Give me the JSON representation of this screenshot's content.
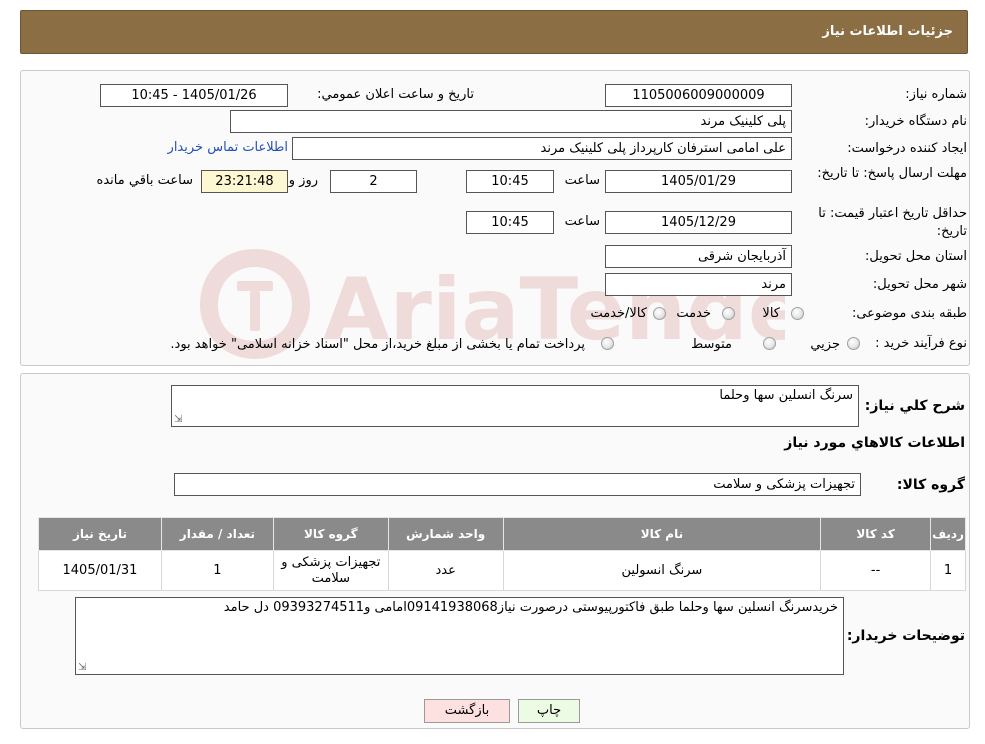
{
  "header": {
    "title": "جزئیات اطلاعات نیاز"
  },
  "watermark": {
    "text": "AriaTender.neT"
  },
  "form": {
    "need_number_label": "شماره نیاز:",
    "need_number": "1105006009000009",
    "announce_label": "تاریخ و ساعت اعلان عمومي:",
    "announce_value": "1405/01/26 - 10:45",
    "buyer_org_label": "نام دستگاه خريدار:",
    "buyer_org": "پلی کلینیک مرند",
    "creator_label": "ايجاد کننده درخواست:",
    "creator": "علی امامی استرفان کارپرداز پلی کلینیک مرند",
    "contact_link": "اطلاعات تماس خريدار",
    "reply_deadline_label": "مهلت ارسال پاسخ: تا تاريخ:",
    "reply_date": "1405/01/29",
    "time_label": "ساعت",
    "reply_time": "10:45",
    "days_value": "2",
    "days_label": "روز و",
    "remaining_time": "23:21:48",
    "remaining_label": "ساعت باقي مانده",
    "price_validity_label": "حداقل تاريخ اعتبار قيمت: تا تاريخ:",
    "price_date": "1405/12/29",
    "price_time": "10:45",
    "province_label": "استان محل تحويل:",
    "province": "آذربایجان شرقی",
    "city_label": "شهر محل تحويل:",
    "city": "مرند",
    "category_label": "طبقه بندی موضوعی:",
    "category_options": [
      "کالا",
      "خدمت",
      "کالا/خدمت"
    ],
    "process_label": "نوع فرآيند خريد :",
    "process_options": [
      "جزيي",
      "متوسط"
    ],
    "process_note": "پرداخت تمام يا بخشی از مبلغ خريد،از محل \"اسناد خزانه اسلامی\" خواهد بود."
  },
  "details": {
    "summary_label": "شرح کلي نياز:",
    "summary": "سرنگ انسلین سها وحلما",
    "items_title": "اطلاعات کالاهاي مورد نياز",
    "group_label": "گروه کالا:",
    "group_value": "تجهیزات پزشکی و سلامت",
    "table": {
      "headers": [
        "رديف",
        "کد کالا",
        "نام کالا",
        "واحد شمارش",
        "گروه کالا",
        "تعداد / مقدار",
        "تاريخ نياز"
      ],
      "rows": [
        [
          "1",
          "--",
          "سرنگ انسولین",
          "عدد",
          "تجهیزات پزشکی و سلامت",
          "1",
          "1405/01/31"
        ]
      ]
    },
    "buyer_notes_label": "توضيحات خريدار:",
    "buyer_notes": "خریدسرنگ انسلین سها وحلما طبق فاکتورپیوستی درصورت نیاز09141938068امامی و09393274511 دل حامد"
  },
  "buttons": {
    "print": "چاپ",
    "back": "بازگشت"
  }
}
